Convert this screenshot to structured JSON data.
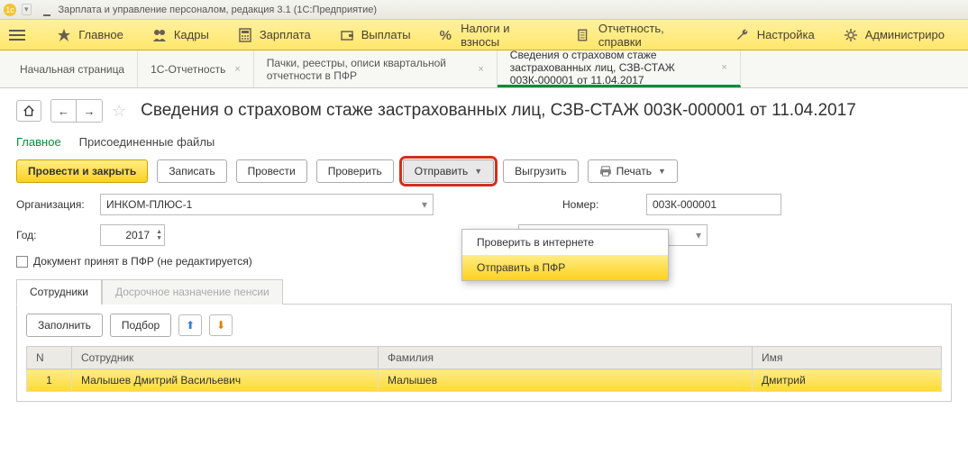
{
  "titlebar": {
    "app_title": "Зарплата и управление персоналом, редакция 3.1 (1С:Предприятие)"
  },
  "menubar": {
    "items": [
      "Главное",
      "Кадры",
      "Зарплата",
      "Выплаты",
      "Налоги и взносы",
      "Отчетность, справки",
      "Настройка",
      "Администриро"
    ]
  },
  "tabs": {
    "items": [
      {
        "label": "Начальная страница"
      },
      {
        "label": "1С-Отчетность"
      },
      {
        "label": "Пачки, реестры, описи квартальной отчетности в ПФР"
      },
      {
        "label": "Сведения о страховом стаже застрахованных лиц, СЗВ-СТАЖ 003К-000001 от 11.04.2017"
      }
    ]
  },
  "doc": {
    "title": "Сведения о страховом стаже застрахованных лиц, СЗВ-СТАЖ 003К-000001 от 11.04.2017"
  },
  "subtabs": {
    "main": "Главное",
    "files": "Присоединенные файлы"
  },
  "buttons": {
    "post_close": "Провести и закрыть",
    "save": "Записать",
    "post": "Провести",
    "check": "Проверить",
    "send": "Отправить",
    "export": "Выгрузить",
    "print": "Печать"
  },
  "dropdown": {
    "check_online": "Проверить в интернете",
    "send_pfr": "Отправить в ПФР"
  },
  "form": {
    "org_label": "Организация:",
    "org_value": "ИНКОМ-ПЛЮС-1",
    "num_label": "Номер:",
    "num_value": "003К-000001",
    "year_label": "Год:",
    "year_value": "2017",
    "cb_label": "Документ принят в ПФР (не редактируется)"
  },
  "tabsheet": {
    "tab1": "Сотрудники",
    "tab2": "Досрочное назначение пенсии"
  },
  "tabbuttons": {
    "fill": "Заполнить",
    "pick": "Подбор"
  },
  "grid": {
    "headers": {
      "n": "N",
      "emp": "Сотрудник",
      "lname": "Фамилия",
      "fname": "Имя"
    },
    "rows": [
      {
        "n": "1",
        "emp": "Малышев Дмитрий Васильевич",
        "lname": "Малышев",
        "fname": "Дмитрий"
      }
    ]
  }
}
